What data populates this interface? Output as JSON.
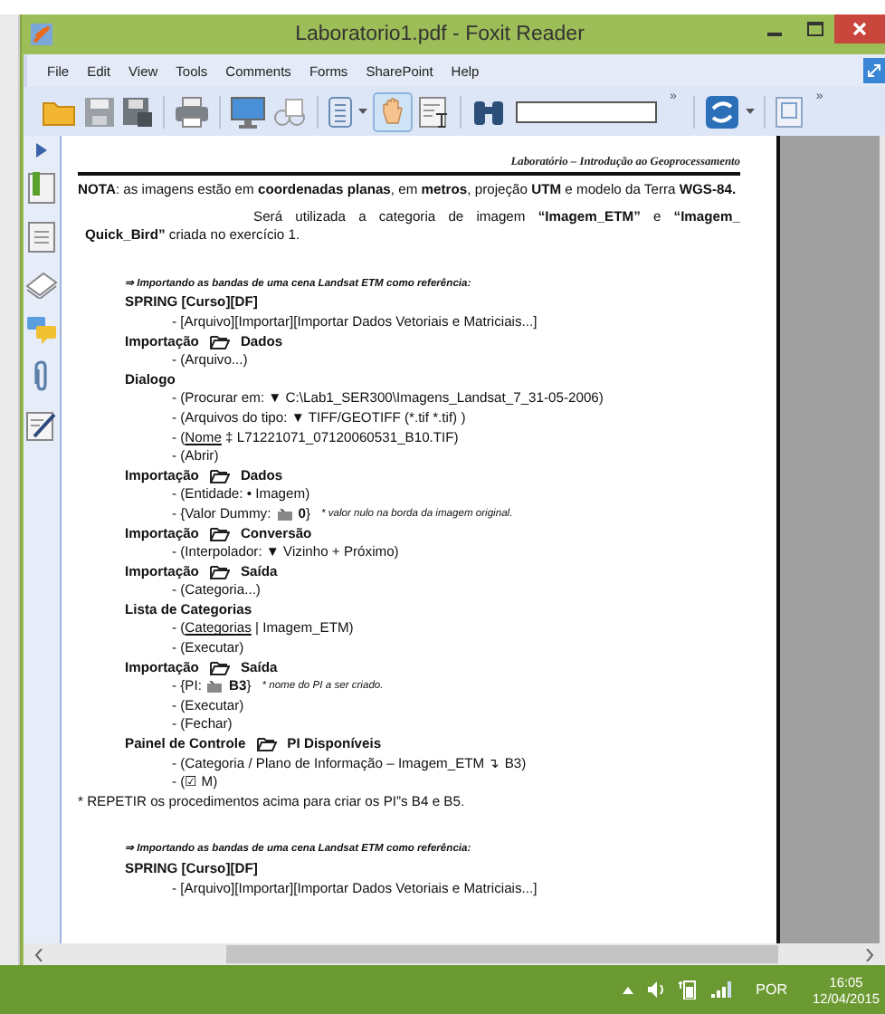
{
  "window": {
    "title": "Laboratorio1.pdf - Foxit Reader"
  },
  "menu": [
    "File",
    "Edit",
    "View",
    "Tools",
    "Comments",
    "Forms",
    "SharePoint",
    "Help"
  ],
  "toolbar": {
    "overflow": [
      "»",
      "»"
    ]
  },
  "document": {
    "header": "Laboratório – Introdução ao Geoprocessamento",
    "lines": [
      {
        "kind": "para",
        "text": "**NOTA**: as imagens estão em **coordenadas planas**, em **metros**, projeção **UTM** e modelo da Terra **WGS-84.**"
      },
      {
        "kind": "para-center",
        "text": "Será utilizada a categoria de imagem **“Imagem_ETM”** e **“Imagem_ Quick_Bird”** criada no exercício 1."
      },
      {
        "kind": "gap"
      },
      {
        "kind": "arrow-note",
        "text": "⇒ Importando as bandas de uma cena Landsat ETM como referência:"
      },
      {
        "kind": "heading",
        "text": "SPRING [Curso][DF]"
      },
      {
        "kind": "step",
        "text": "- [Arquivo][Importar][Importar Dados Vetoriais e Matriciais...]"
      },
      {
        "kind": "heading-folder",
        "text": "Importação",
        "target": "Dados"
      },
      {
        "kind": "step",
        "text": "- (Arquivo...)"
      },
      {
        "kind": "heading",
        "text": "Dialogo"
      },
      {
        "kind": "step",
        "text": "- (Procurar em: ▼ C:\\Lab1_SER300\\Imagens_Landsat_7_31-05-2006)"
      },
      {
        "kind": "step",
        "text": "- (Arquivos do tipo: ▼ TIFF/GEOTIFF (*.tif *.tif) )"
      },
      {
        "kind": "step-underline",
        "pre": "- (",
        "underlined": "Nome",
        "post": " ‡ L71221071_07120060531_B10.TIF)"
      },
      {
        "kind": "step",
        "text": "- (Abrir)"
      },
      {
        "kind": "heading-folder",
        "text": "Importação",
        "target": "Dados"
      },
      {
        "kind": "step",
        "text": "- (Entidade: • Imagem)"
      },
      {
        "kind": "step-icon",
        "text": "- {Valor Dummy:",
        "value": "**0**}",
        "note": "* valor nulo na borda da imagem original."
      },
      {
        "kind": "heading-folder",
        "text": "Importação",
        "target": "Conversão"
      },
      {
        "kind": "step",
        "text": "- (Interpolador: ▼ Vizinho + Próximo)"
      },
      {
        "kind": "heading-folder",
        "text": "Importação",
        "target": "Saída"
      },
      {
        "kind": "step",
        "text": "- (Categoria...)"
      },
      {
        "kind": "heading",
        "text": "Lista de Categorias"
      },
      {
        "kind": "step-underline",
        "pre": "- (",
        "underlined": "Categorias",
        "post": " | Imagem_ETM)"
      },
      {
        "kind": "step",
        "text": "- (Executar)"
      },
      {
        "kind": "heading-folder",
        "text": "Importação",
        "target": "Saída"
      },
      {
        "kind": "step-icon",
        "text": "- {PI:",
        "value": "**B3**}",
        "note": "* nome do PI a ser criado."
      },
      {
        "kind": "step",
        "text": "- (Executar)"
      },
      {
        "kind": "step",
        "text": "- (Fechar)"
      },
      {
        "kind": "heading-folder",
        "text": "Painel de Controle",
        "target": "PI Disponíveis"
      },
      {
        "kind": "step",
        "text": "- (Categoria / Plano de Informação – Imagem_ETM ↴ B3)"
      },
      {
        "kind": "step",
        "text": "- (☑ M)"
      },
      {
        "kind": "para",
        "text": "* REPETIR os procedimentos acima para criar os PI”s  B4  e  B5."
      },
      {
        "kind": "gap"
      },
      {
        "kind": "arrow-note",
        "text": "⇒ Importando as bandas de uma cena Landsat ETM como referência:"
      },
      {
        "kind": "heading",
        "text": "SPRING [Curso][DF]"
      },
      {
        "kind": "step",
        "text": "- [Arquivo][Importar][Importar Dados Vetoriais e Matriciais...]"
      }
    ]
  },
  "taskbar": {
    "language": "POR",
    "time": "16:05",
    "date": "12/04/2015"
  }
}
